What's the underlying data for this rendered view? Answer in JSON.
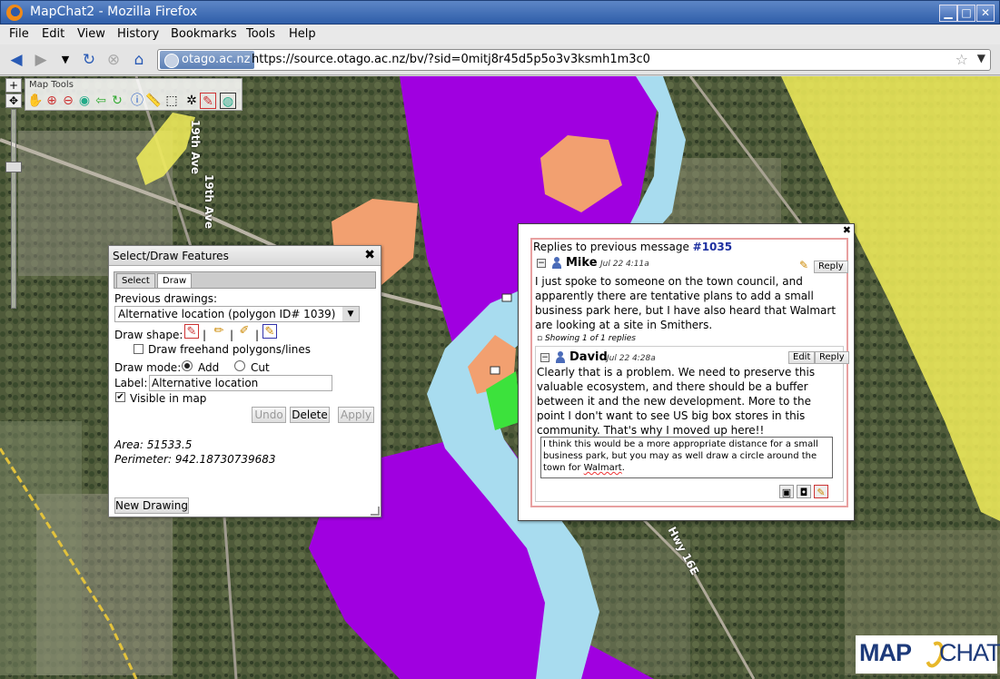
{
  "window": {
    "title": "MapChat2 - Mozilla Firefox",
    "controls": [
      "minimize",
      "maximize",
      "close"
    ]
  },
  "menu": [
    "File",
    "Edit",
    "View",
    "History",
    "Bookmarks",
    "Tools",
    "Help"
  ],
  "nav": {
    "site_identity": "otago.ac.nz",
    "url": "https://source.otago.ac.nz/bv/?sid=0mitj8r45d5p5o3v3ksmh1m3c0"
  },
  "map": {
    "tools_title": "Map Tools",
    "road_labels": [
      "19th Ave",
      "19th Ave",
      "Hwy 16E"
    ],
    "colors": {
      "river": "#a8dcef",
      "zone": "#a000e0",
      "yellow": "#f2ef5a",
      "orange": "#f2a070",
      "green": "#3ce23c"
    }
  },
  "select_draw": {
    "title": "Select/Draw Features",
    "tabs": [
      "Select",
      "Draw"
    ],
    "previous_drawings_label": "Previous drawings:",
    "previous_drawings_value": "Alternative location (polygon ID# 1039)",
    "draw_shape_label": "Draw shape:",
    "freehand_label": "Draw freehand polygons/lines",
    "draw_mode_label": "Draw mode:",
    "mode_add": "Add",
    "mode_cut": "Cut",
    "label_label": "Label:",
    "label_value": "Alternative location",
    "visible_label": "Visible in map",
    "undo": "Undo",
    "delete": "Delete",
    "apply": "Apply",
    "area": "Area: 51533.5",
    "perimeter": "Perimeter: 942.18730739683",
    "new_drawing": "New Drawing"
  },
  "thread": {
    "header_prefix": "Replies to previous message",
    "header_id": "#1035",
    "message1": {
      "author": "Mike",
      "date": "Jul 22 4:11a",
      "reply": "Reply",
      "body": "I just spoke to someone on the town council, and apparently there are tentative plans to add a small business park here, but I have also heard that Walmart are looking at a site in Smithers."
    },
    "showing": "Showing 1 of 1 replies",
    "message2": {
      "author": "David",
      "date": "Jul 22 4:28a",
      "edit": "Edit",
      "reply": "Reply",
      "body": "Clearly that is a problem.  We need to preserve this valuable ecosystem, and there should be a buffer between it and the new development. More to the point I don't want to see US big box stores in this community. That's why I moved up here!!"
    },
    "draft_before": "I think this would be a more appropriate distance for a small business park, but you may as well draw a circle around the town for ",
    "draft_misspelled": "Walmart",
    "draft_after": "."
  },
  "logo": {
    "part1": "MAP",
    "part2": "CHAT"
  }
}
